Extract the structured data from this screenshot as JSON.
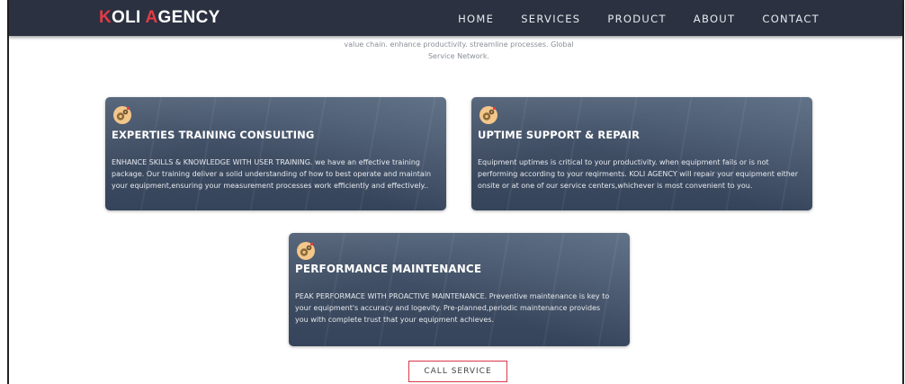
{
  "brand": {
    "logo_part1_accent": "K",
    "logo_part1": "OLI ",
    "logo_part2_accent": "A",
    "logo_part2": "GENCY",
    "accent_color": "#e23b45",
    "nav_bg": "#2b3140"
  },
  "nav": {
    "items": [
      {
        "label": "HOME"
      },
      {
        "label": "SERVICES"
      },
      {
        "label": "PRODUCT"
      },
      {
        "label": "ABOUT"
      },
      {
        "label": "CONTACT"
      }
    ]
  },
  "intro": {
    "line1": "value chain. enhance productivity. streamline processes. Global",
    "line2": "Service Network."
  },
  "cards": [
    {
      "icon": "gears-icon",
      "title": "EXPERTIES TRAINING CONSULTING",
      "text": "ENHANCE SKILLS & KNOWLEDGE WITH USER TRAINING. we have an effective training package. Our training deliver a solid understanding of how to best operate and maintain your equipment,ensuring your measurement processes work efficiently and effectively.."
    },
    {
      "icon": "gears-icon",
      "title": "UPTIME SUPPORT & REPAIR",
      "text": "Equipment uptimes is critical to your productivity. when equipment fails or is not performing according to your reqirments. KOLI AGENCY will repair your equipment either onsite or at one of our service centers,whichever is most convenient to you."
    },
    {
      "icon": "gears-icon",
      "title": "PERFORMANCE MAINTENANCE",
      "text": "PEAK PERFORMACE WITH PROACTIVE MAINTENANCE. Preventive maintenance is key to your equipment's accuracy and logevity. Pre-planned,periodic maintenance provides you with complete trust that your equipment achieves."
    }
  ],
  "cta": {
    "label": "CALL SERVICE",
    "border_color": "#d8384a"
  }
}
